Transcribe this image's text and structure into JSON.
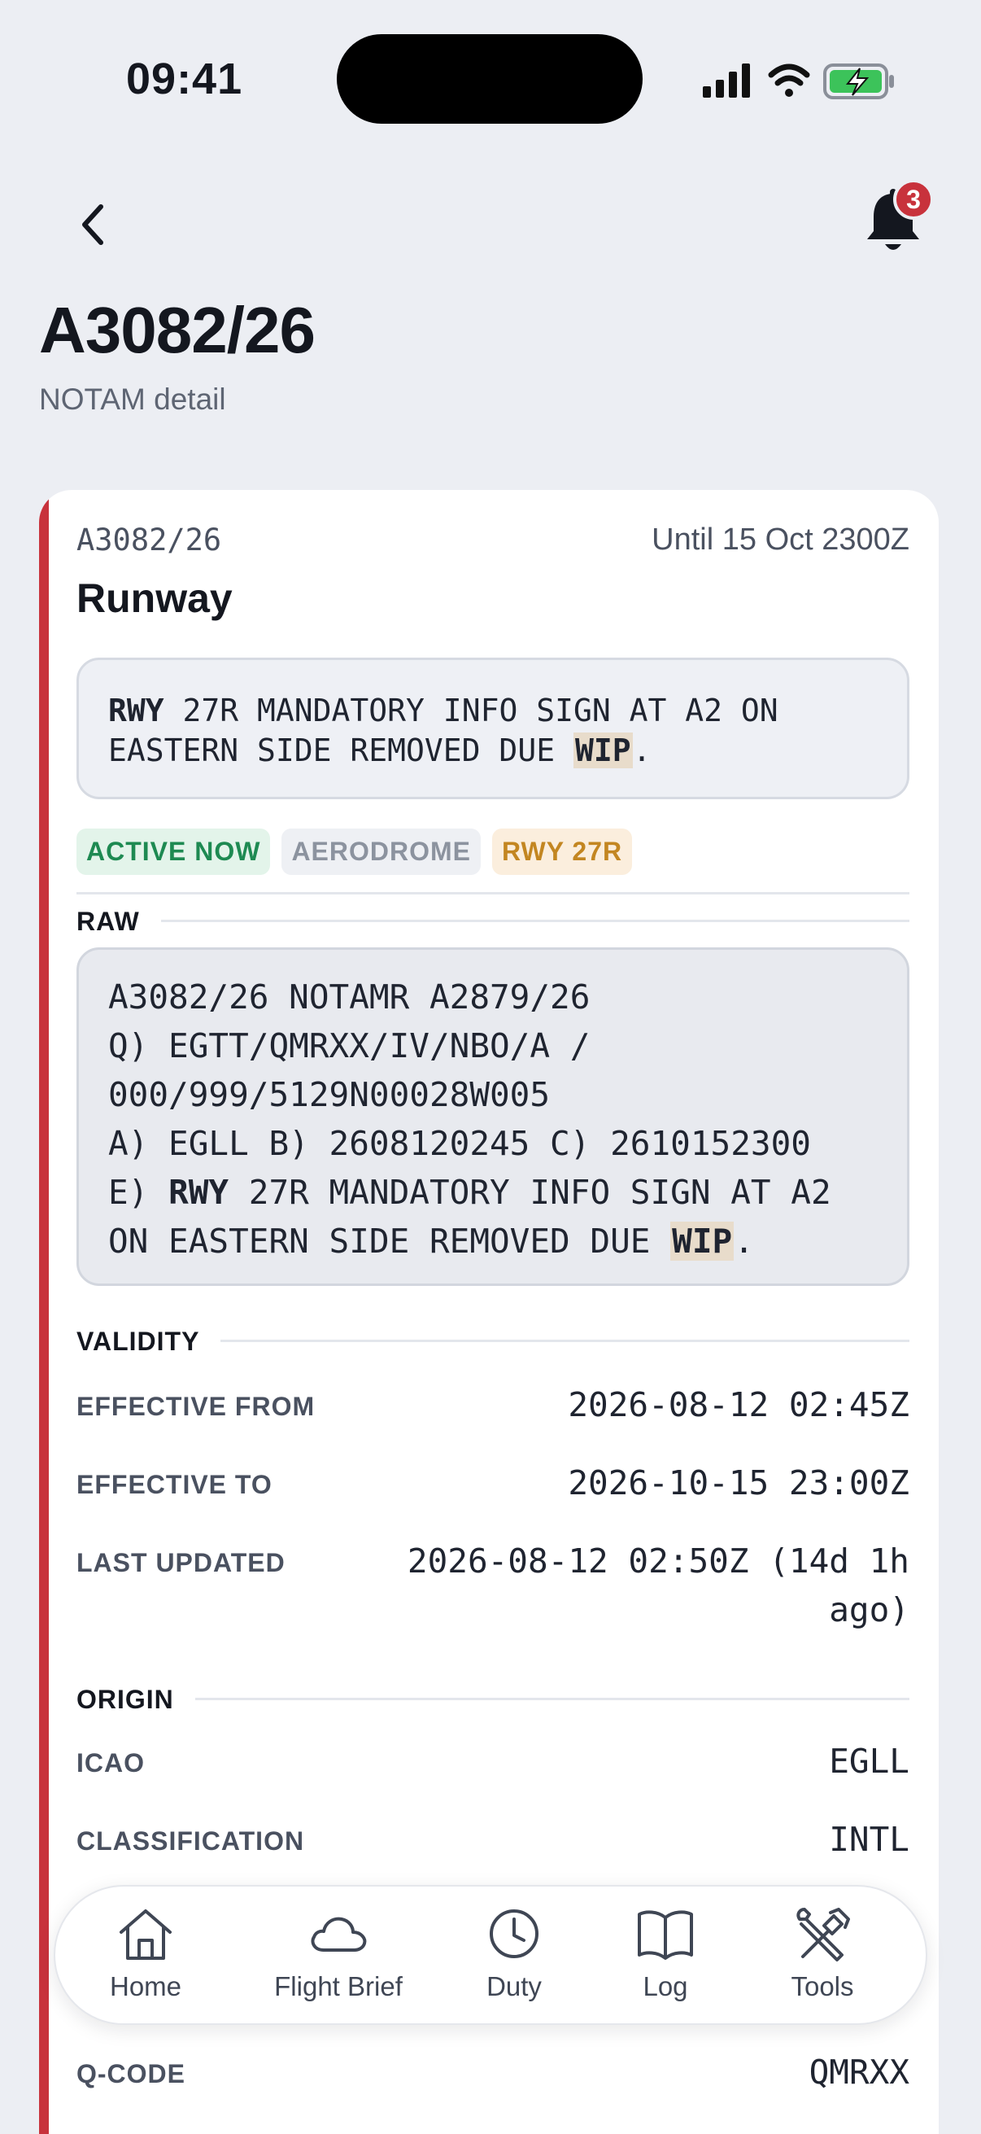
{
  "status_bar": {
    "time": "09:41"
  },
  "header": {
    "notification_count": "3",
    "title": "A3082/26",
    "subtitle": "NOTAM detail"
  },
  "notam": {
    "id": "A3082/26",
    "until": "Until 15 Oct 2300Z",
    "category": "Runway",
    "summary": {
      "bold_word": "RWY",
      "text_middle": " 27R MANDATORY INFO SIGN AT A2 ON EASTERN SIDE REMOVED DUE ",
      "wip": "WIP",
      "end": "."
    },
    "tags": [
      "ACTIVE NOW",
      "AERODROME",
      "RWY 27R"
    ],
    "raw_section_label": "RAW",
    "raw": {
      "line1": "A3082/26 NOTAMR A2879/26",
      "line2": "Q) EGTT/QMRXX/IV/NBO/A /",
      "line3": "000/999/5129N00028W005",
      "line4": "A) EGLL B) 2608120245 C) 2610152300",
      "line5_prefix": "E) ",
      "line5_bold": "RWY",
      "line5_rest": " 27R MANDATORY INFO SIGN AT A2",
      "line6_prefix": "ON EASTERN SIDE REMOVED DUE ",
      "line6_wip": "WIP",
      "line6_end": "."
    },
    "validity": {
      "section_label": "VALIDITY",
      "effective_from_label": "EFFECTIVE FROM",
      "effective_from": "2026-08-12 02:45Z",
      "effective_to_label": "EFFECTIVE TO",
      "effective_to": "2026-10-15 23:00Z",
      "last_updated_label": "LAST UPDATED",
      "last_updated_line1": "2026-08-12 02:50Z (14d 1h",
      "last_updated_line2": "ago)"
    },
    "origin": {
      "section_label": "ORIGIN",
      "icao_label": "ICAO",
      "icao": "EGLL",
      "classification_label": "CLASSIFICATION",
      "classification": "INTL",
      "qcode_label": "Q-CODE",
      "qcode": "QMRXX"
    }
  },
  "bottom_nav": {
    "items": [
      {
        "label": "Home",
        "icon": "home-icon"
      },
      {
        "label": "Flight Brief",
        "icon": "cloud-icon"
      },
      {
        "label": "Duty",
        "icon": "clock-icon"
      },
      {
        "label": "Log",
        "icon": "book-icon"
      },
      {
        "label": "Tools",
        "icon": "tools-icon"
      }
    ]
  },
  "colors": {
    "accent_red": "#c8323c",
    "active_green": "#1e8a52",
    "rwy_amber": "#c38621",
    "background": "#eceef3"
  }
}
